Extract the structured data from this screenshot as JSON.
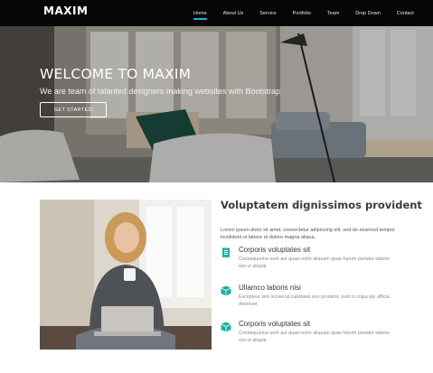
{
  "header": {
    "logo": "MAXIM",
    "nav": [
      {
        "label": "Home",
        "active": true
      },
      {
        "label": "About Us",
        "active": false
      },
      {
        "label": "Service",
        "active": false
      },
      {
        "label": "Portfolio",
        "active": false
      },
      {
        "label": "Team",
        "active": false
      },
      {
        "label": "Drop Down",
        "active": false
      },
      {
        "label": "Contact",
        "active": false
      }
    ]
  },
  "hero": {
    "title": "WELCOME TO MAXIM",
    "subtitle": "We are team of talanted designers making websites with Bootstrap",
    "button": "GET STARTED"
  },
  "about": {
    "title": "Voluptatem dignissimos provident",
    "description": "Lorem ipsum dolor sit amet, consectetur adipiscing elit, sed do eiusmod tempor incididunt ut labore et dolore magna aliqua.",
    "features": [
      {
        "icon": "receipt-icon",
        "title": "Corporis voluptates sit",
        "text": "Consequuntur sunt aut quasi enim aliquam quae harum pariatur laboris nisi ut aliquip"
      },
      {
        "icon": "cube-icon",
        "title": "Ullamco laboris nisi",
        "text": "Excepteur sint occaecat cupidatat non proident, sunt in culpa qui officia deserunt"
      },
      {
        "icon": "cube-icon",
        "title": "Corporis voluptates sit",
        "text": "Consequuntur sunt aut quasi enim aliquam quae harum pariatur laboris nisi ut aliquip"
      }
    ]
  },
  "colors": {
    "accent": "#1bb1dc",
    "icon": "#1bb1a0",
    "nav_bg": "#060606"
  }
}
